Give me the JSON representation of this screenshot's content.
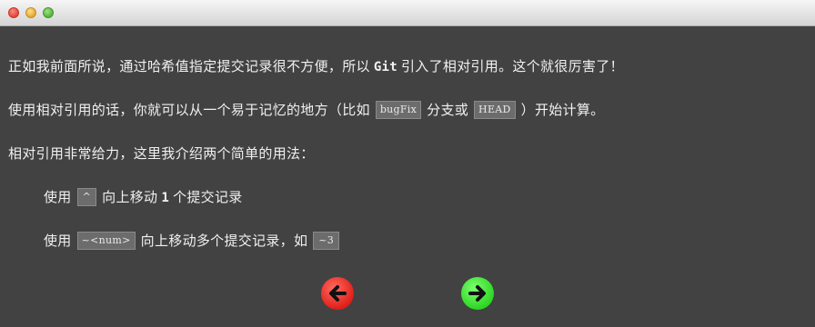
{
  "window": {
    "controls": [
      "close",
      "minimize",
      "maximize"
    ]
  },
  "dialog": {
    "para1": {
      "before": "正如我前面所说，通过哈希值指定提交记录很不方便，所以",
      "git": "Git",
      "after": "引入了相对引用。这个就很厉害了！"
    },
    "para2": {
      "before": "使用相对引用的话，你就可以从一个易于记忆的地方（比如",
      "code1": "bugFix",
      "middle": "分支或",
      "code2": "HEAD",
      "after": "）开始计算。"
    },
    "para3": "相对引用非常给力，这里我介绍两个简单的用法：",
    "item1": {
      "before": "使用",
      "code": "^",
      "middle": "向上移动",
      "num": "1",
      "after": "个提交记录"
    },
    "item2": {
      "before": "使用",
      "code": "~<num>",
      "middle": "向上移动多个提交记录，如",
      "code2": "~3"
    }
  },
  "nav": {
    "prev_icon": "left-arrow-icon",
    "next_icon": "right-arrow-icon",
    "prev_color": "#e8302a",
    "next_color": "#3bd92e"
  }
}
